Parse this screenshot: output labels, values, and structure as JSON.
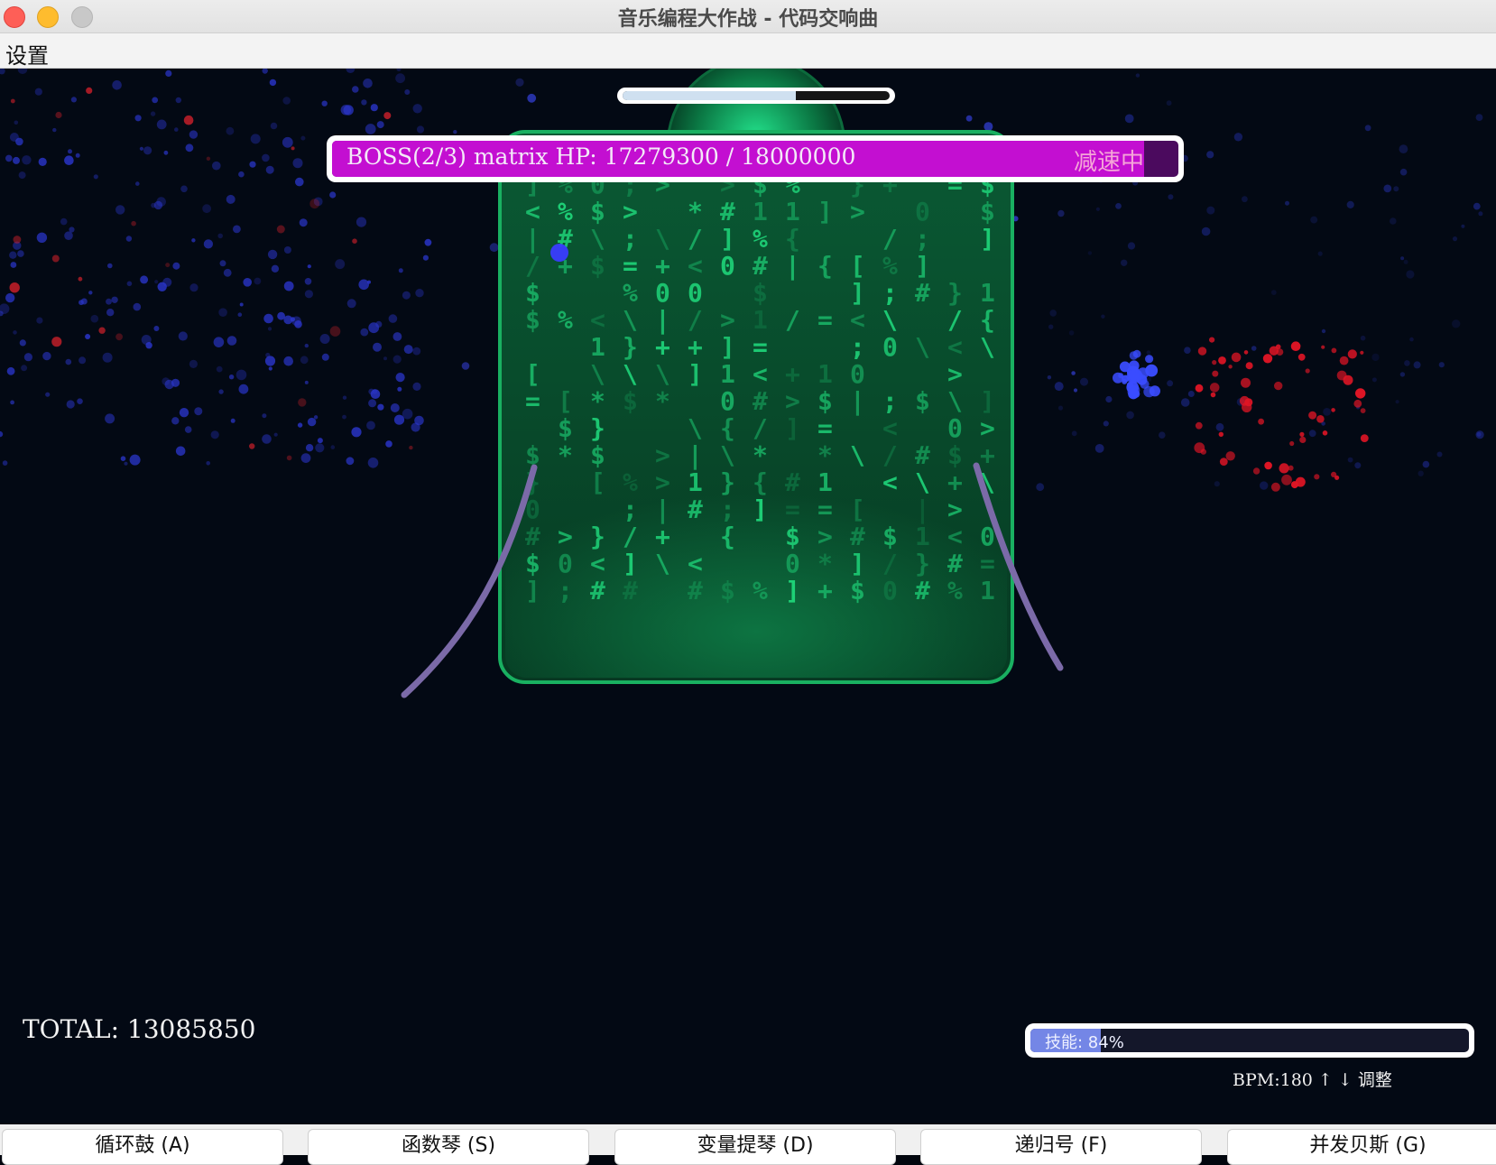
{
  "window": {
    "title": "音乐编程大作战 - 代码交响曲"
  },
  "menu": {
    "settings": "设置"
  },
  "boss": {
    "label": "BOSS(2/3) matrix HP: 17279300 / 18000000",
    "hp_current": 17279300,
    "hp_max": 18000000,
    "status": "减速中",
    "timer_fraction": 0.65
  },
  "matrix_chars": "01{}[]<>%$#*+=;/|\\",
  "score": {
    "total_label": "TOTAL: 13085850"
  },
  "skill": {
    "label": "技能: 84%",
    "percent": 0.16
  },
  "bpm": {
    "label": "BPM:180 ↑ ↓ 调整"
  },
  "instruments": [
    {
      "label": "循环鼓 (A)"
    },
    {
      "label": "函数琴 (S)"
    },
    {
      "label": "变量提琴 (D)"
    },
    {
      "label": "递归号 (F)"
    },
    {
      "label": "并发贝斯 (G)"
    }
  ],
  "colors": {
    "background": "#030914",
    "hp_fill": "#c30fd1",
    "hp_track": "#4b0a5e",
    "matrix_green": "#1fd67a",
    "skill_fill": "#7486e6",
    "tentacle": "#7b6aa8"
  }
}
